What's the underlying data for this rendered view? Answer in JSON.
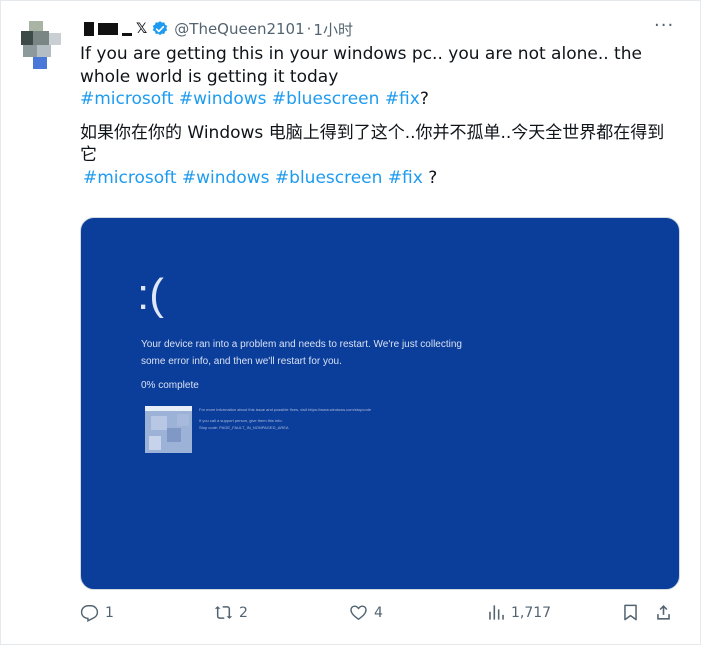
{
  "tweet": {
    "handle": "@TheQueen2101",
    "separator": "·",
    "time": "1小时",
    "text_en": "If you are getting this in your windows pc.. you are not alone.. the whole world is getting it today",
    "hashtags_en": "#microsoft #windows #bluescreen #fix",
    "hashtags_en_suffix": "?",
    "text_zh": "如果你在你的 Windows 电脑上得到了这个..你并不孤单..今天全世界都在得到它",
    "hashtags_zh": "#microsoft #windows #bluescreen #fix",
    "hashtags_zh_suffix": " ?"
  },
  "bsod": {
    "face": ":(",
    "message": "Your device ran into a problem and needs to restart. We're just collecting some error info, and then we'll restart for you.",
    "progress": "0% complete",
    "fine_print_1": "For more information about this issue and possible fixes, visit https://www.windows.com/stopcode",
    "fine_print_2": "If you call a support person, give them this info:",
    "fine_print_3": "Stop code: PAGE_FAULT_IN_NONPAGED_AREA"
  },
  "actions": {
    "replies": "1",
    "reposts": "2",
    "likes": "4",
    "views": "1,717"
  },
  "icons": {
    "verified": "verified-badge-icon",
    "more": "more-icon",
    "reply": "reply-icon",
    "repost": "repost-icon",
    "like": "like-icon",
    "views": "views-icon",
    "bookmark": "bookmark-icon",
    "share": "share-icon"
  },
  "colors": {
    "link": "#1d9bf0",
    "bsod_blue": "#0b3d9a",
    "verified": "#1d9bf0",
    "muted": "#536471"
  }
}
